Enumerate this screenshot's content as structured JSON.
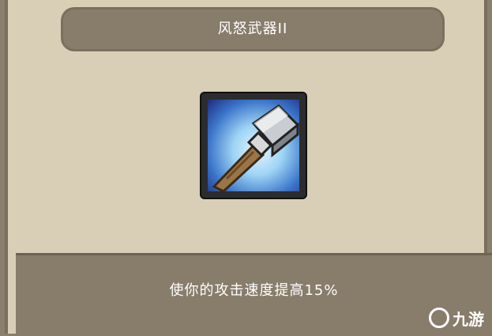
{
  "title": "风怒武器II",
  "item": {
    "icon": "war-hammer-icon"
  },
  "description": "使你的攻击速度提高15%",
  "watermark": {
    "text": "九游"
  },
  "colors": {
    "panel": "#d9cfb6",
    "banner": "#887c6b",
    "text": "#ffffff",
    "frame": "#2c2c2c"
  }
}
